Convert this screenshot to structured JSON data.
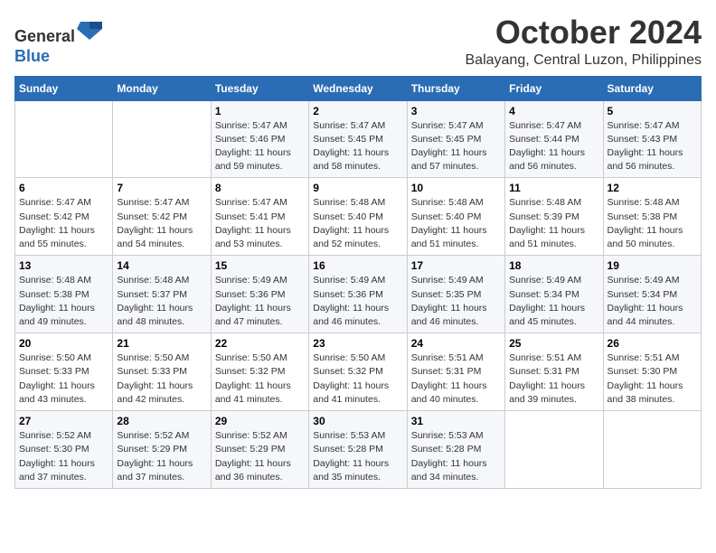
{
  "header": {
    "logo_line1": "General",
    "logo_line2": "Blue",
    "month_title": "October 2024",
    "location": "Balayang, Central Luzon, Philippines"
  },
  "days_of_week": [
    "Sunday",
    "Monday",
    "Tuesday",
    "Wednesday",
    "Thursday",
    "Friday",
    "Saturday"
  ],
  "weeks": [
    [
      {
        "day": "",
        "sunrise": "",
        "sunset": "",
        "daylight": ""
      },
      {
        "day": "",
        "sunrise": "",
        "sunset": "",
        "daylight": ""
      },
      {
        "day": "1",
        "sunrise": "Sunrise: 5:47 AM",
        "sunset": "Sunset: 5:46 PM",
        "daylight": "Daylight: 11 hours and 59 minutes."
      },
      {
        "day": "2",
        "sunrise": "Sunrise: 5:47 AM",
        "sunset": "Sunset: 5:45 PM",
        "daylight": "Daylight: 11 hours and 58 minutes."
      },
      {
        "day": "3",
        "sunrise": "Sunrise: 5:47 AM",
        "sunset": "Sunset: 5:45 PM",
        "daylight": "Daylight: 11 hours and 57 minutes."
      },
      {
        "day": "4",
        "sunrise": "Sunrise: 5:47 AM",
        "sunset": "Sunset: 5:44 PM",
        "daylight": "Daylight: 11 hours and 56 minutes."
      },
      {
        "day": "5",
        "sunrise": "Sunrise: 5:47 AM",
        "sunset": "Sunset: 5:43 PM",
        "daylight": "Daylight: 11 hours and 56 minutes."
      }
    ],
    [
      {
        "day": "6",
        "sunrise": "Sunrise: 5:47 AM",
        "sunset": "Sunset: 5:42 PM",
        "daylight": "Daylight: 11 hours and 55 minutes."
      },
      {
        "day": "7",
        "sunrise": "Sunrise: 5:47 AM",
        "sunset": "Sunset: 5:42 PM",
        "daylight": "Daylight: 11 hours and 54 minutes."
      },
      {
        "day": "8",
        "sunrise": "Sunrise: 5:47 AM",
        "sunset": "Sunset: 5:41 PM",
        "daylight": "Daylight: 11 hours and 53 minutes."
      },
      {
        "day": "9",
        "sunrise": "Sunrise: 5:48 AM",
        "sunset": "Sunset: 5:40 PM",
        "daylight": "Daylight: 11 hours and 52 minutes."
      },
      {
        "day": "10",
        "sunrise": "Sunrise: 5:48 AM",
        "sunset": "Sunset: 5:40 PM",
        "daylight": "Daylight: 11 hours and 51 minutes."
      },
      {
        "day": "11",
        "sunrise": "Sunrise: 5:48 AM",
        "sunset": "Sunset: 5:39 PM",
        "daylight": "Daylight: 11 hours and 51 minutes."
      },
      {
        "day": "12",
        "sunrise": "Sunrise: 5:48 AM",
        "sunset": "Sunset: 5:38 PM",
        "daylight": "Daylight: 11 hours and 50 minutes."
      }
    ],
    [
      {
        "day": "13",
        "sunrise": "Sunrise: 5:48 AM",
        "sunset": "Sunset: 5:38 PM",
        "daylight": "Daylight: 11 hours and 49 minutes."
      },
      {
        "day": "14",
        "sunrise": "Sunrise: 5:48 AM",
        "sunset": "Sunset: 5:37 PM",
        "daylight": "Daylight: 11 hours and 48 minutes."
      },
      {
        "day": "15",
        "sunrise": "Sunrise: 5:49 AM",
        "sunset": "Sunset: 5:36 PM",
        "daylight": "Daylight: 11 hours and 47 minutes."
      },
      {
        "day": "16",
        "sunrise": "Sunrise: 5:49 AM",
        "sunset": "Sunset: 5:36 PM",
        "daylight": "Daylight: 11 hours and 46 minutes."
      },
      {
        "day": "17",
        "sunrise": "Sunrise: 5:49 AM",
        "sunset": "Sunset: 5:35 PM",
        "daylight": "Daylight: 11 hours and 46 minutes."
      },
      {
        "day": "18",
        "sunrise": "Sunrise: 5:49 AM",
        "sunset": "Sunset: 5:34 PM",
        "daylight": "Daylight: 11 hours and 45 minutes."
      },
      {
        "day": "19",
        "sunrise": "Sunrise: 5:49 AM",
        "sunset": "Sunset: 5:34 PM",
        "daylight": "Daylight: 11 hours and 44 minutes."
      }
    ],
    [
      {
        "day": "20",
        "sunrise": "Sunrise: 5:50 AM",
        "sunset": "Sunset: 5:33 PM",
        "daylight": "Daylight: 11 hours and 43 minutes."
      },
      {
        "day": "21",
        "sunrise": "Sunrise: 5:50 AM",
        "sunset": "Sunset: 5:33 PM",
        "daylight": "Daylight: 11 hours and 42 minutes."
      },
      {
        "day": "22",
        "sunrise": "Sunrise: 5:50 AM",
        "sunset": "Sunset: 5:32 PM",
        "daylight": "Daylight: 11 hours and 41 minutes."
      },
      {
        "day": "23",
        "sunrise": "Sunrise: 5:50 AM",
        "sunset": "Sunset: 5:32 PM",
        "daylight": "Daylight: 11 hours and 41 minutes."
      },
      {
        "day": "24",
        "sunrise": "Sunrise: 5:51 AM",
        "sunset": "Sunset: 5:31 PM",
        "daylight": "Daylight: 11 hours and 40 minutes."
      },
      {
        "day": "25",
        "sunrise": "Sunrise: 5:51 AM",
        "sunset": "Sunset: 5:31 PM",
        "daylight": "Daylight: 11 hours and 39 minutes."
      },
      {
        "day": "26",
        "sunrise": "Sunrise: 5:51 AM",
        "sunset": "Sunset: 5:30 PM",
        "daylight": "Daylight: 11 hours and 38 minutes."
      }
    ],
    [
      {
        "day": "27",
        "sunrise": "Sunrise: 5:52 AM",
        "sunset": "Sunset: 5:30 PM",
        "daylight": "Daylight: 11 hours and 37 minutes."
      },
      {
        "day": "28",
        "sunrise": "Sunrise: 5:52 AM",
        "sunset": "Sunset: 5:29 PM",
        "daylight": "Daylight: 11 hours and 37 minutes."
      },
      {
        "day": "29",
        "sunrise": "Sunrise: 5:52 AM",
        "sunset": "Sunset: 5:29 PM",
        "daylight": "Daylight: 11 hours and 36 minutes."
      },
      {
        "day": "30",
        "sunrise": "Sunrise: 5:53 AM",
        "sunset": "Sunset: 5:28 PM",
        "daylight": "Daylight: 11 hours and 35 minutes."
      },
      {
        "day": "31",
        "sunrise": "Sunrise: 5:53 AM",
        "sunset": "Sunset: 5:28 PM",
        "daylight": "Daylight: 11 hours and 34 minutes."
      },
      {
        "day": "",
        "sunrise": "",
        "sunset": "",
        "daylight": ""
      },
      {
        "day": "",
        "sunrise": "",
        "sunset": "",
        "daylight": ""
      }
    ]
  ]
}
